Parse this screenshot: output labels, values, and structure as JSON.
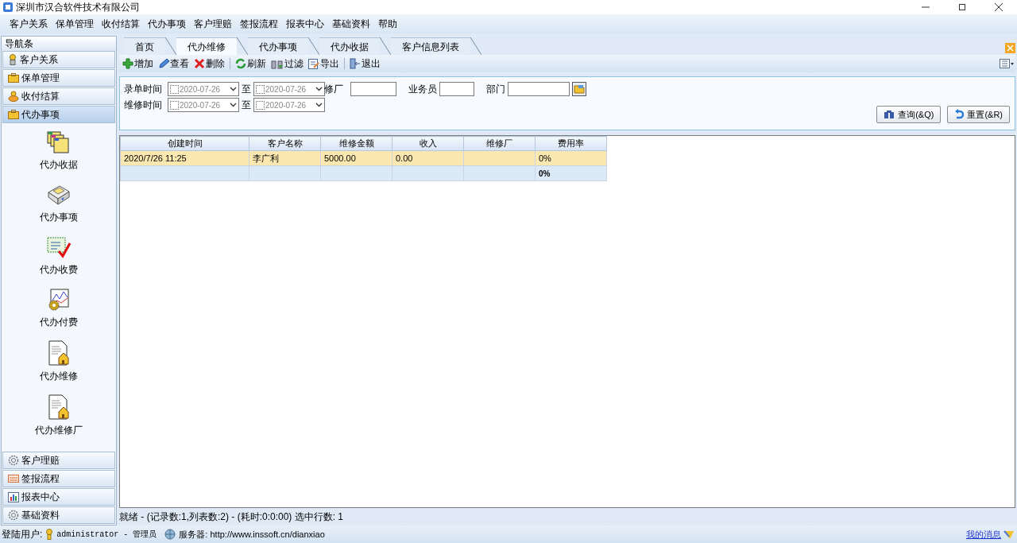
{
  "window": {
    "title": "深圳市汉合软件技术有限公司"
  },
  "menu": [
    "客户关系",
    "保单管理",
    "收付结算",
    "代办事项",
    "客户理赔",
    "签报流程",
    "报表中心",
    "基础资料",
    "帮助"
  ],
  "nav": {
    "title": "导航条",
    "top_groups": [
      {
        "label": "客户关系",
        "selected": false
      },
      {
        "label": "保单管理",
        "selected": false
      },
      {
        "label": "收付结算",
        "selected": false
      },
      {
        "label": "代办事项",
        "selected": true
      }
    ],
    "items": [
      "代办收据",
      "代办事项",
      "代办收费",
      "代办付费",
      "代办维修",
      "代办维修厂"
    ],
    "bottom_groups": [
      {
        "label": "客户理赔",
        "selected": false
      },
      {
        "label": "签报流程",
        "selected": false
      },
      {
        "label": "报表中心",
        "selected": false
      },
      {
        "label": "基础资料",
        "selected": false
      }
    ]
  },
  "tabs": [
    {
      "label": "首页",
      "selected": false
    },
    {
      "label": "代办维修",
      "selected": true
    },
    {
      "label": "代办事项",
      "selected": false
    },
    {
      "label": "代办收据",
      "selected": false
    },
    {
      "label": "客户信息列表",
      "selected": false
    }
  ],
  "toolbar": [
    "增加",
    "查看",
    "删除",
    "刷新",
    "过滤",
    "导出",
    "退出"
  ],
  "filters": {
    "row_1": [
      {
        "kind": "date",
        "label": "录单时间",
        "value": "2020-07-26",
        "checked": false
      },
      {
        "kind": "date",
        "label": "至",
        "value": "2020-07-26",
        "checked": false
      },
      {
        "kind": "text",
        "label": "修厂"
      },
      {
        "kind": "text",
        "label": "业务员"
      },
      {
        "kind": "picker",
        "label": "部门"
      }
    ],
    "row_2": [
      {
        "kind": "date",
        "label": "维修时间",
        "value": "2020-07-26",
        "checked": false
      },
      {
        "kind": "date",
        "label": "至",
        "value": "2020-07-26",
        "checked": false
      }
    ],
    "buttons": [
      "查询(&Q)",
      "重置(&R)"
    ]
  },
  "table": {
    "columns": [
      "创建时间",
      "客户名称",
      "维修金额",
      "收入",
      "维修厂",
      "费用率"
    ],
    "rows": [
      {
        "cells": [
          "2020/7/26 11:25",
          "李广利",
          "5000.00",
          "0.00",
          "",
          "0%"
        ],
        "selected": true
      }
    ],
    "summary": {
      "fee_rate": "0%"
    }
  },
  "status_bar": "就绪 - (记录数:1,列表数:2) - (耗时:0:0:00) 选中行数: 1",
  "footer": {
    "user_label": "登陆用户:",
    "user": "administrator - 管理员",
    "server": "服务器: http://www.inssoft.cn/dianxiao",
    "messages_link": "我的消息"
  }
}
